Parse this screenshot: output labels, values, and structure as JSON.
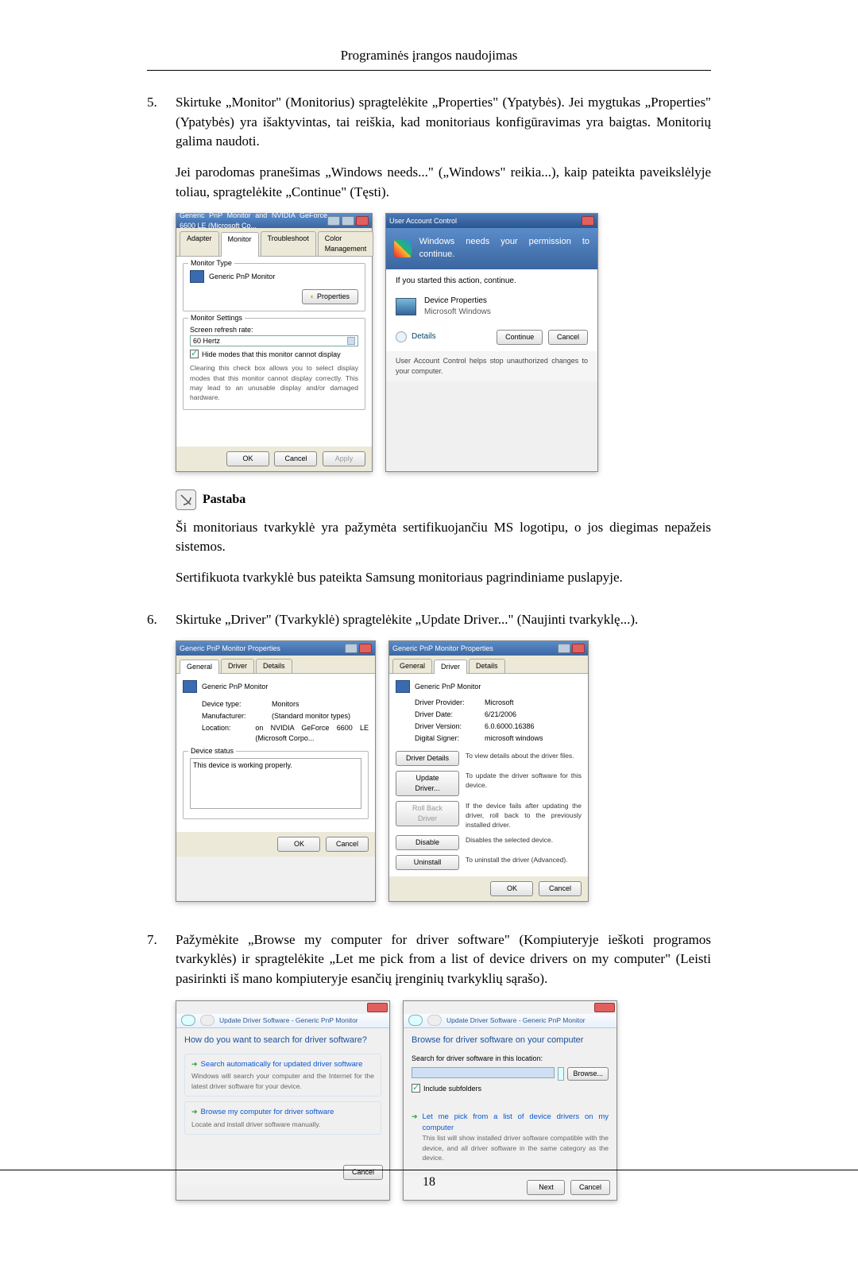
{
  "header": "Programinės įrangos naudojimas",
  "page_number": "18",
  "steps": {
    "s5": {
      "num": "5.",
      "p1": "Skirtuke „Monitor\" (Monitorius) spragtelėkite „Properties\" (Ypatybės). Jei mygtukas „Properties\" (Ypatybės) yra išaktyvintas, tai reiškia, kad monitoriaus konfigūravimas yra baigtas. Monitorių galima naudoti.",
      "p2": "Jei parodomas pranešimas „Windows needs...\" („Windows\" reikia...), kaip pateikta paveikslėlyje toliau, spragtelėkite „Continue\" (Tęsti)."
    },
    "s6": {
      "num": "6.",
      "p1": "Skirtuke „Driver\" (Tvarkyklė) spragtelėkite „Update Driver...\" (Naujinti tvarkyklę...)."
    },
    "s7": {
      "num": "7.",
      "p1": "Pažymėkite „Browse my computer for driver software\" (Kompiuteryje ieškoti programos tvarkyklės) ir spragtelėkite „Let me pick from a list of device drivers on my computer\" (Leisti pasirinkti iš mano kompiuteryje esančių įrenginių tvarkyklių sąrašo)."
    }
  },
  "note": {
    "label": "Pastaba",
    "p1": "Ši monitoriaus tvarkyklė yra pažymėta sertifikuojančiu MS logotipu, o jos diegimas nepažeis sistemos.",
    "p2": "Sertifikuota tvarkyklė bus pateikta Samsung monitoriaus pagrindiniame puslapyje."
  },
  "dlg1": {
    "title": "Generic PnP Monitor and NVIDIA GeForce 6600 LE (Microsoft Co...",
    "tabs": [
      "Adapter",
      "Monitor",
      "Troubleshoot",
      "Color Management"
    ],
    "active_tab": "Monitor",
    "group_type": "Monitor Type",
    "monitor_name": "Generic PnP Monitor",
    "properties_btn": "Properties",
    "group_settings": "Monitor Settings",
    "refresh_label": "Screen refresh rate:",
    "refresh_value": "60 Hertz",
    "hide_modes": "Hide modes that this monitor cannot display",
    "hide_help": "Clearing this check box allows you to select display modes that this monitor cannot display correctly. This may lead to an unusable display and/or damaged hardware.",
    "ok": "OK",
    "cancel": "Cancel",
    "apply": "Apply"
  },
  "uac": {
    "title": "User Account Control",
    "headline": "Windows needs your permission to continue.",
    "started": "If you started this action, continue.",
    "app": "Device Properties",
    "vendor": "Microsoft Windows",
    "details": "Details",
    "continue": "Continue",
    "cancel": "Cancel",
    "footer": "User Account Control helps stop unauthorized changes to your computer."
  },
  "props_general": {
    "title": "Generic PnP Monitor Properties",
    "tabs": [
      "General",
      "Driver",
      "Details"
    ],
    "monitor_name": "Generic PnP Monitor",
    "device_type_k": "Device type:",
    "device_type_v": "Monitors",
    "manuf_k": "Manufacturer:",
    "manuf_v": "(Standard monitor types)",
    "loc_k": "Location:",
    "loc_v": "on NVIDIA GeForce 6600 LE (Microsoft Corpo...",
    "status_group": "Device status",
    "status_text": "This device is working properly.",
    "ok": "OK",
    "cancel": "Cancel"
  },
  "props_driver": {
    "title": "Generic PnP Monitor Properties",
    "tabs": [
      "General",
      "Driver",
      "Details"
    ],
    "monitor_name": "Generic PnP Monitor",
    "provider_k": "Driver Provider:",
    "provider_v": "Microsoft",
    "date_k": "Driver Date:",
    "date_v": "6/21/2006",
    "version_k": "Driver Version:",
    "version_v": "6.0.6000.16386",
    "signer_k": "Digital Signer:",
    "signer_v": "microsoft windows",
    "btn_details": "Driver Details",
    "btn_details_d": "To view details about the driver files.",
    "btn_update": "Update Driver...",
    "btn_update_d": "To update the driver software for this device.",
    "btn_rollback": "Roll Back Driver",
    "btn_rollback_d": "If the device fails after updating the driver, roll back to the previously installed driver.",
    "btn_disable": "Disable",
    "btn_disable_d": "Disables the selected device.",
    "btn_uninstall": "Uninstall",
    "btn_uninstall_d": "To uninstall the driver (Advanced).",
    "ok": "OK",
    "cancel": "Cancel"
  },
  "wiz1": {
    "breadcrumb": "Update Driver Software - Generic PnP Monitor",
    "heading": "How do you want to search for driver software?",
    "opt1_t": "Search automatically for updated driver software",
    "opt1_s": "Windows will search your computer and the Internet for the latest driver software for your device.",
    "opt2_t": "Browse my computer for driver software",
    "opt2_s": "Locate and install driver software manually.",
    "cancel": "Cancel"
  },
  "wiz2": {
    "breadcrumb": "Update Driver Software - Generic PnP Monitor",
    "heading": "Browse for driver software on your computer",
    "search_label": "Search for driver software in this location:",
    "browse": "Browse...",
    "include": "Include subfolders",
    "pick_t": "Let me pick from a list of device drivers on my computer",
    "pick_s": "This list will show installed driver software compatible with the device, and all driver software in the same category as the device.",
    "next": "Next",
    "cancel": "Cancel"
  }
}
